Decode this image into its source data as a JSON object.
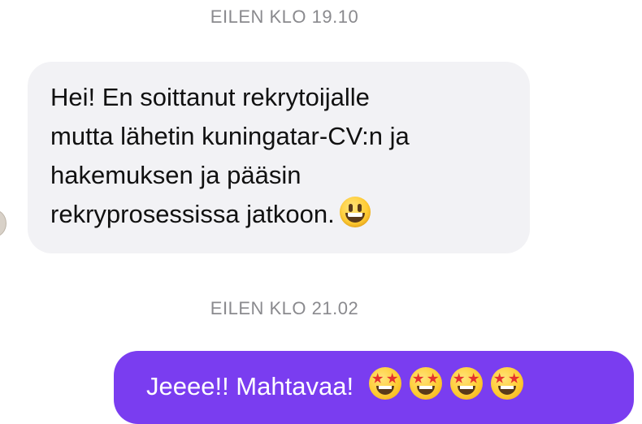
{
  "conversation": {
    "messages": [
      {
        "timestamp": "EILEN KLO 19.10",
        "direction": "incoming",
        "lines": [
          "Hei! En soittanut rekrytoijalle",
          "mutta lähetin kuningatar-CV:n ja",
          "hakemuksen ja pääsin",
          "rekryprosessissa jatkoon."
        ],
        "emoji": [
          "grinning-face"
        ]
      },
      {
        "timestamp": "EILEN KLO 21.02",
        "direction": "outgoing",
        "text": "Jeeee!! Mahtavaa!",
        "emoji": [
          "star-struck",
          "star-struck",
          "star-struck",
          "star-struck"
        ]
      }
    ]
  },
  "colors": {
    "outgoing_bubble": "#7a3df0",
    "incoming_bubble": "#f2f2f5",
    "timestamp_text": "#8a8a8e"
  }
}
